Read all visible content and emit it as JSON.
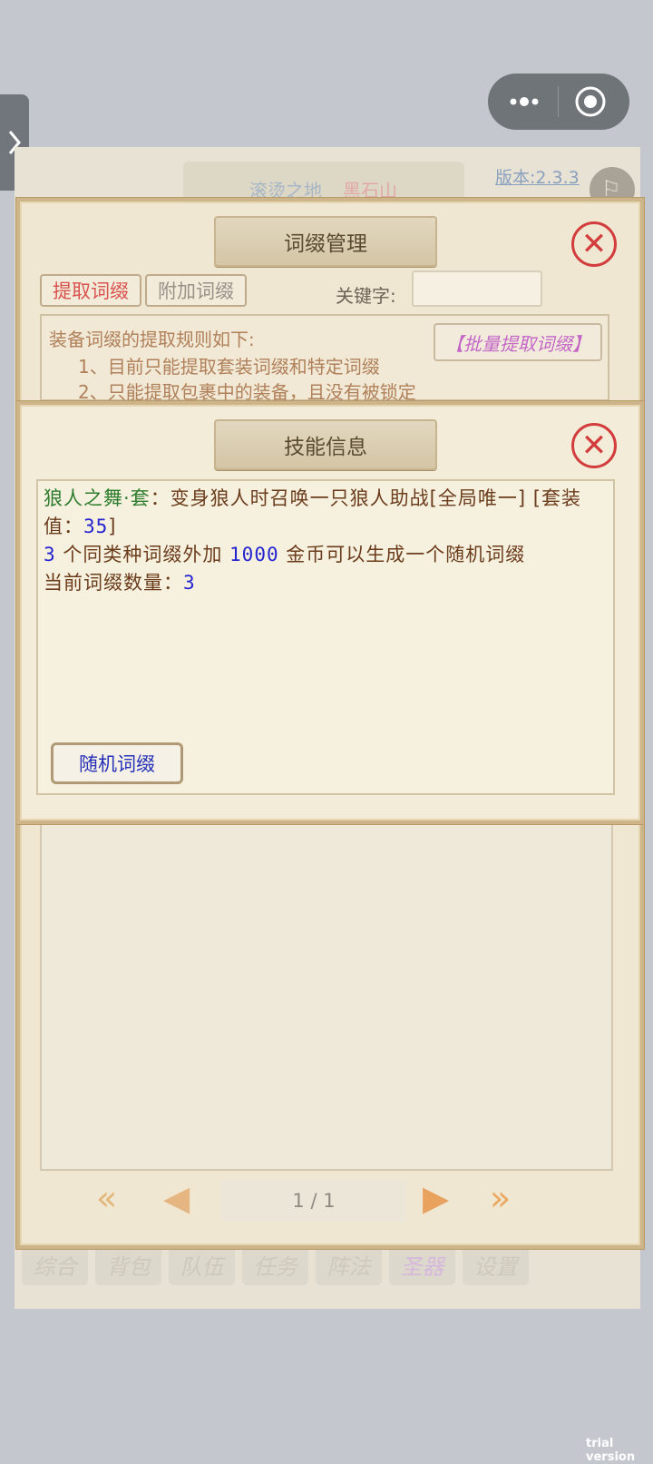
{
  "mini_program": {
    "more_icon": "ellipsis-icon",
    "close_icon": "target-circle-icon"
  },
  "game_header": {
    "location_main": "滚烫之地",
    "location_sub": "黑石山",
    "version": "版本:2.3.3",
    "avatar_glyph": "⚐"
  },
  "bottom_nav": {
    "items": [
      "综合",
      "背包",
      "队伍",
      "任务",
      "阵法",
      "圣器",
      "设置"
    ]
  },
  "affix_panel": {
    "title": "词缀管理",
    "tab_extract": "提取词缀",
    "tab_attach": "附加词缀",
    "keyword_label": "关键字:",
    "keyword_value": "",
    "rules_title": "装备词缀的提取规则如下:",
    "rule_1": "1、目前只能提取套装词缀和特定词缀",
    "rule_2": "2、只能提取包裹中的装备，且没有被锁定",
    "batch_extract": "【批量提取词缀】",
    "page_indicator": "1 / 1"
  },
  "skill_panel": {
    "title": "技能信息",
    "affix_name": "狼人之舞·套",
    "affix_desc": "：变身狼人时召唤一只狼人助战[全局唯一] [套装值：",
    "set_value": "35",
    "set_close": "]",
    "count_num": "3",
    "cost_mid": "个同类种词缀外加",
    "cost_gold": "1000",
    "cost_tail": "金币可以生成一个随机词缀",
    "current_label": "当前词缀数量：",
    "current_count": "3",
    "random_button": "随机词缀"
  },
  "watermark": "trial version",
  "colors": {
    "affix_name": "#2e7d2e",
    "body_text": "#6b3c1c",
    "number": "#2424d0",
    "close": "#d23c3c",
    "tab_active": "#d9534f",
    "batch_button": "#c466c6"
  }
}
